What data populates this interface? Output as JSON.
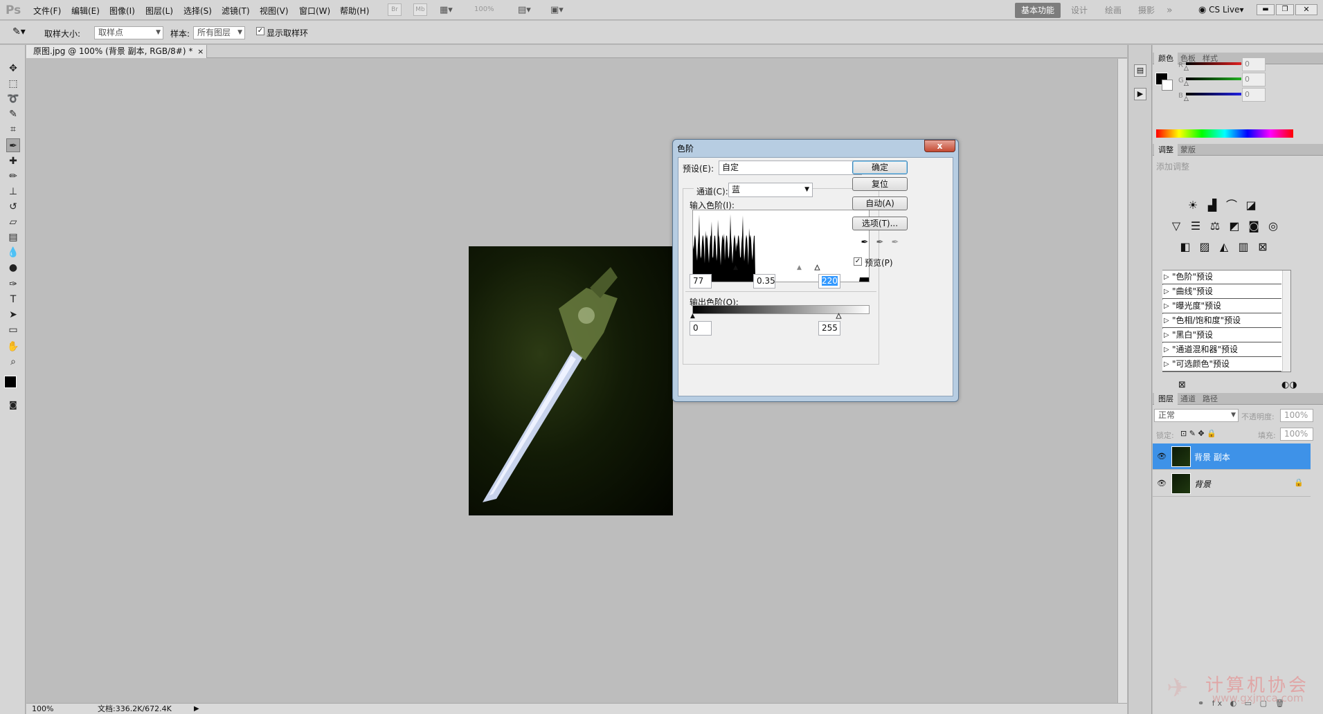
{
  "app": {
    "logo": "Ps"
  },
  "menubar": {
    "items": [
      "文件(F)",
      "编辑(E)",
      "图像(I)",
      "图层(L)",
      "选择(S)",
      "滤镜(T)",
      "视图(V)",
      "窗口(W)",
      "帮助(H)"
    ],
    "tool_btns": [
      "Br",
      "Mb"
    ],
    "zoom": "100%",
    "workspaces": [
      "基本功能",
      "设计",
      "绘画",
      "摄影"
    ],
    "more": "»",
    "cs_live": "CS Live"
  },
  "options": {
    "sample_size_label": "取样大小:",
    "sample_size_value": "取样点",
    "sample_label": "样本:",
    "sample_value": "所有图层",
    "show_ring_label": "显示取样环",
    "show_ring_checked": true
  },
  "document": {
    "tab_title": "原图.jpg @ 100% (背景 副本, RGB/8#) *",
    "close": "×",
    "status_zoom": "100%",
    "status_doc": "文档:336.2K/672.4K"
  },
  "levels_dialog": {
    "title": "色阶",
    "close": "x",
    "preset_label": "预设(E):",
    "preset_value": "自定",
    "channel_label": "通道(C):",
    "channel_value": "蓝",
    "input_label": "输入色阶(I):",
    "input_black": "77",
    "input_gamma": "0.35",
    "input_white": "220",
    "output_label": "输出色阶(O):",
    "output_black": "0",
    "output_white": "255",
    "buttons": {
      "ok": "确定",
      "reset": "复位",
      "auto": "自动(A)",
      "options": "选项(T)..."
    },
    "preview_label": "预览(P)",
    "preview_checked": true
  },
  "color_panel": {
    "tabs": [
      "颜色",
      "色板",
      "样式"
    ],
    "channels": [
      {
        "label": "R",
        "value": "0",
        "color": "#e02020"
      },
      {
        "label": "G",
        "value": "0",
        "color": "#20b020"
      },
      {
        "label": "B",
        "value": "0",
        "color": "#2020e0"
      }
    ]
  },
  "adjust_panel": {
    "tabs": [
      "调整",
      "蒙版"
    ],
    "title": "添加调整",
    "icons_row1": [
      "brightness-icon",
      "levels-icon",
      "curves-icon",
      "exposure-icon"
    ],
    "icons_row2": [
      "vibrance-icon",
      "hue-saturation-icon",
      "color-balance-icon",
      "black-white-icon",
      "photo-filter-icon",
      "channel-mixer-icon"
    ],
    "icons_row3": [
      "invert-icon",
      "posterize-icon",
      "threshold-icon",
      "gradient-map-icon",
      "selective-color-icon"
    ],
    "presets": [
      "\"色阶\"预设",
      "\"曲线\"预设",
      "\"曝光度\"预设",
      "\"色相/饱和度\"预设",
      "\"黑白\"预设",
      "\"通道混和器\"预设",
      "\"可选颜色\"预设"
    ]
  },
  "layers_panel": {
    "tabs": [
      "图层",
      "通道",
      "路径"
    ],
    "blend_mode": "正常",
    "opacity_label": "不透明度:",
    "opacity": "100%",
    "lock_label": "锁定:",
    "fill_label": "填充:",
    "fill": "100%",
    "layers": [
      {
        "name": "背景 副本",
        "selected": true,
        "locked": false
      },
      {
        "name": "背景",
        "selected": false,
        "locked": true
      }
    ]
  },
  "watermark": {
    "cn": "计算机协会",
    "url": "www.gxjmca.com"
  }
}
